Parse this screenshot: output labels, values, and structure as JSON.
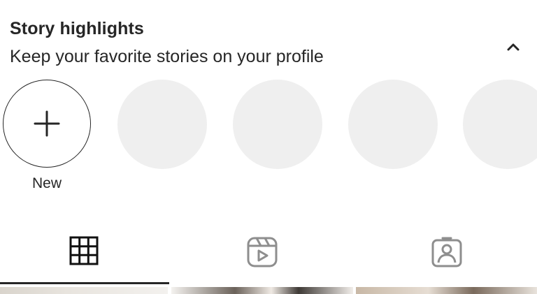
{
  "section": {
    "title": "Story highlights",
    "subtitle": "Keep your favorite stories on your profile"
  },
  "highlights": {
    "new_label": "New",
    "placeholder_count": 4
  },
  "icons": {
    "collapse": "chevron-up-icon",
    "new": "plus-icon",
    "tab_posts": "grid-icon",
    "tab_reels": "reels-icon",
    "tab_tagged": "tagged-person-icon"
  },
  "tabs": {
    "active": "posts"
  },
  "colors": {
    "text": "#262626",
    "placeholder": "#efefef",
    "inactive_icon": "#8e8e8e"
  }
}
